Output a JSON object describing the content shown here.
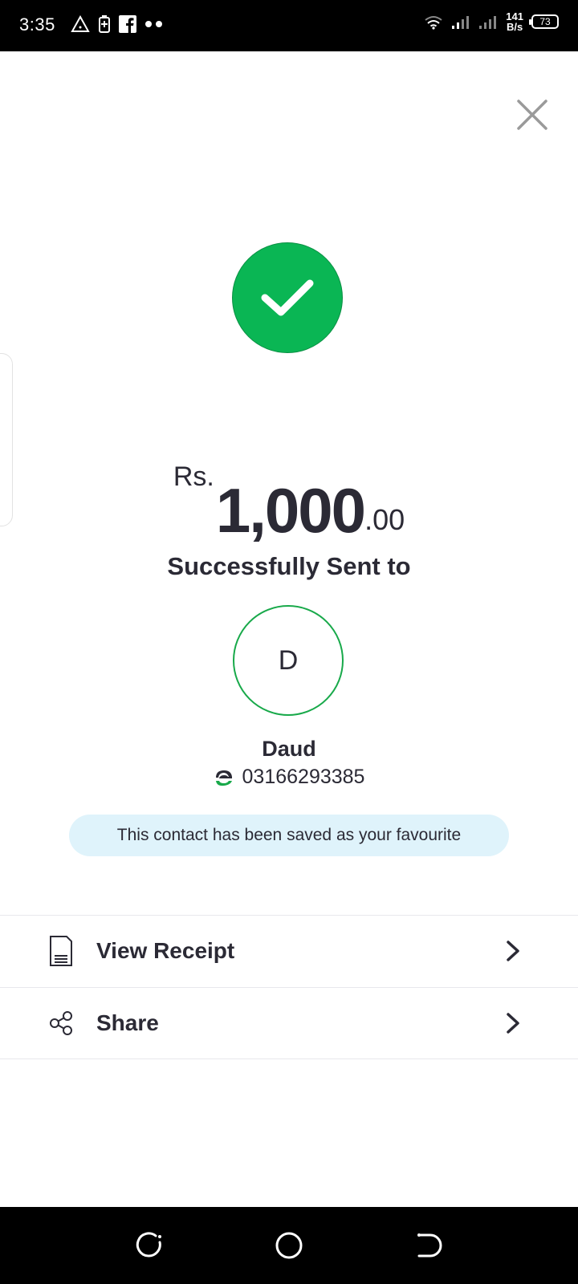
{
  "status_bar": {
    "time": "3:35",
    "net_speed_value": "141",
    "net_speed_unit": "B/s",
    "battery_level": "73"
  },
  "transaction": {
    "currency": "Rs.",
    "amount_main": "1,000",
    "amount_decimal": ".00",
    "status_text": "Successfully Sent to"
  },
  "recipient": {
    "initial": "D",
    "name": "Daud",
    "phone": "03166293385"
  },
  "banner": {
    "text": "This contact has been saved as your favourite"
  },
  "actions": [
    {
      "label": "View Receipt",
      "icon": "receipt-icon"
    },
    {
      "label": "Share",
      "icon": "share-icon"
    }
  ],
  "colors": {
    "success_green": "#0ab654",
    "avatar_border": "#18a94a",
    "banner_bg": "#dff3fb",
    "text_dark": "#2b2a35"
  }
}
